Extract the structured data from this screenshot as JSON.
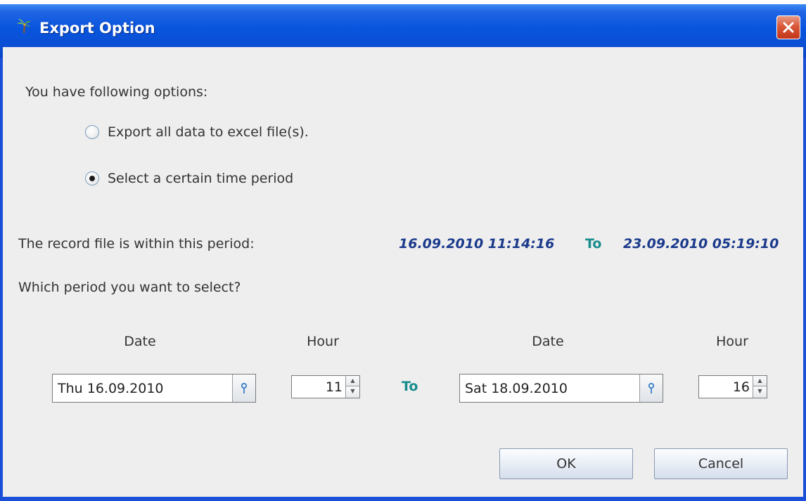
{
  "window": {
    "title": "Export Option"
  },
  "intro": {
    "heading": "You have following options:"
  },
  "options": [
    {
      "label": "Export all data to excel file(s).",
      "selected": false
    },
    {
      "label": "Select a certain time period",
      "selected": true
    }
  ],
  "record_period": {
    "label": "The record file is within this period:",
    "start": "16.09.2010 11:14:16",
    "to_label": "To",
    "end": "23.09.2010 05:19:10"
  },
  "selection": {
    "question": "Which period you want to select?",
    "from": {
      "date_header": "Date",
      "hour_header": "Hour",
      "date_value": "Thu 16.09.2010",
      "hour_value": "11"
    },
    "to_label": "To",
    "to": {
      "date_header": "Date",
      "hour_header": "Hour",
      "date_value": "Sat 18.09.2010",
      "hour_value": "16"
    }
  },
  "buttons": {
    "ok": "OK",
    "cancel": "Cancel"
  },
  "colors": {
    "titlebar": "#0855dd",
    "period_value": "#1b3a8c",
    "to_label": "#188c8c",
    "client_bg": "#eeeeee"
  },
  "icons": {
    "title": "palm-tree-icon",
    "close": "close-icon",
    "date_picker": "pin-icon",
    "spinner_up": "arrow-up-icon",
    "spinner_down": "arrow-down-icon"
  }
}
